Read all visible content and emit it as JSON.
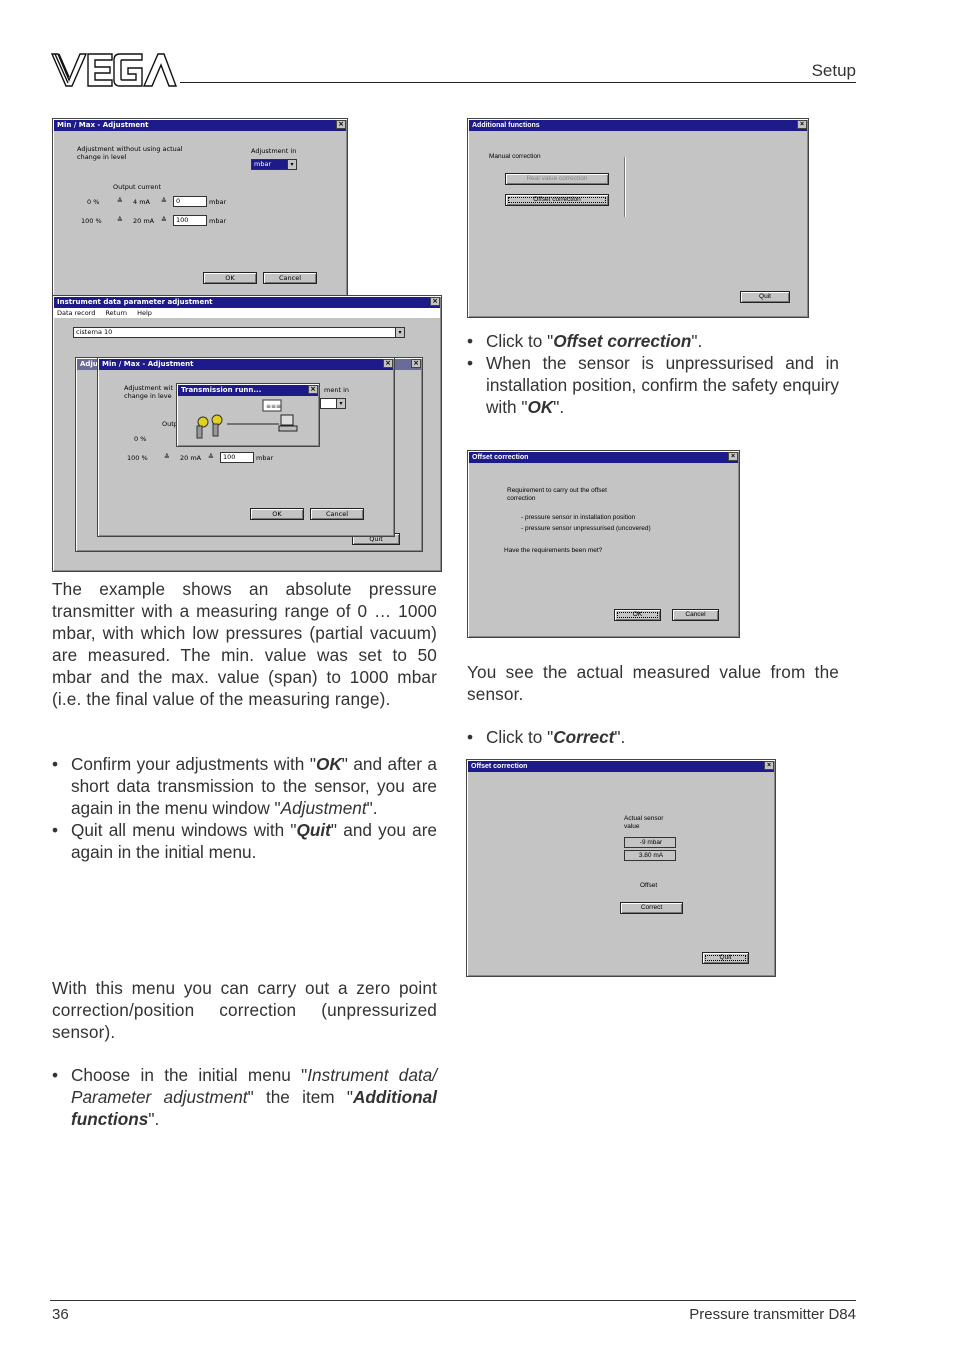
{
  "header": {
    "logo_text": "VEGA",
    "section": "Setup"
  },
  "footer": {
    "page_number": "36",
    "title": "Pressure transmitter D84"
  },
  "left": {
    "para1": "The example shows an absolute pressure transmitter with a measuring range of 0 … 1000 mbar, with which low pressures (partial vacuum) are measured. The min. value was set to 50 mbar and the max. value (span) to 1000 mbar (i.e. the final value of the measuring range).",
    "bullet1": {
      "a": "Confirm your adjustments with \"",
      "b": "OK",
      "c": "\" and after a short data transmission to the sensor, you are again in the menu window \"",
      "d": "Adjustment",
      "e": "\"."
    },
    "bullet2": {
      "a": "Quit all menu windows with \"",
      "b": "Quit",
      "c": "\" and you are again in the initial menu."
    },
    "para2": "With this menu you can carry out a zero point correction/position correction (unpressurized sensor).",
    "bullet3": {
      "a": "Choose in the initial menu \"",
      "b": "Instrument data/ Parameter adjustment",
      "c": "\" the item \"",
      "d": "Additional functions",
      "e": "\"."
    }
  },
  "right": {
    "bullet1": {
      "a": "Click to \"",
      "b": "Offset correction",
      "c": "\"."
    },
    "bullet2": {
      "a": "When the sensor is unpressurised and in installation position, confirm the safety enquiry with \"",
      "b": "OK",
      "c": "\"."
    },
    "para1": "You see the actual measured value from the sensor.",
    "bullet3": {
      "a": "Click to \"",
      "b": "Correct",
      "c": "\"."
    }
  },
  "shot1": {
    "minmax": {
      "title": "Min / Max - Adjustment",
      "desc": "Adjustment without using actual change in level",
      "adjust_in_label": "Adjustment in",
      "adjust_in_value": "mbar",
      "output_current_label": "Output current",
      "row0_pct": "0 %",
      "row0_ma": "4 mA",
      "row0_val": "0",
      "row0_unit": "mbar",
      "row1_pct": "100 %",
      "row1_ma": "20 mA",
      "row1_val": "100",
      "row1_unit": "mbar",
      "ok": "OK",
      "cancel": "Cancel"
    },
    "instrument": {
      "title": "Instrument data parameter adjustment",
      "menu": [
        "Data record",
        "Return",
        "Help"
      ],
      "combo": "cisterna 10",
      "back_title": "Adjus",
      "quit": "Quit"
    },
    "minmax2": {
      "title": "Min / Max - Adjustment",
      "desc_a": "Adjustment wit",
      "desc_b": "change in leve",
      "adjust_in": "ment in",
      "out_label": "Outp",
      "row0_pct": "0 %",
      "row1_pct": "100 %",
      "row1_ma": "20 mA",
      "row1_val": "100",
      "row1_unit": "mbar",
      "ok": "OK",
      "cancel": "Cancel"
    },
    "transmission": {
      "title": "Transmission runn..."
    }
  },
  "shot2": {
    "title": "Additional functions",
    "group": "Manual correction",
    "btn_real": "Real value correction",
    "btn_offset": "Offset correction",
    "quit": "Quit"
  },
  "shot3": {
    "title": "Offset correction",
    "line1": "Requirement to carry out the offset",
    "line2": "correction",
    "line3": "- pressure sensor in installation position",
    "line4": "- pressure sensor unpressurised (uncovered)",
    "question": "Have the requirements been met?",
    "ok": "OK",
    "cancel": "Cancel"
  },
  "shot4": {
    "title": "Offset correction",
    "actual_label_a": "Actual sensor",
    "actual_label_b": "value",
    "val_mbar": "-9 mbar",
    "val_ma": "3.80 mA",
    "offset_label": "Offset",
    "correct": "Correct",
    "quit": "Quit"
  }
}
